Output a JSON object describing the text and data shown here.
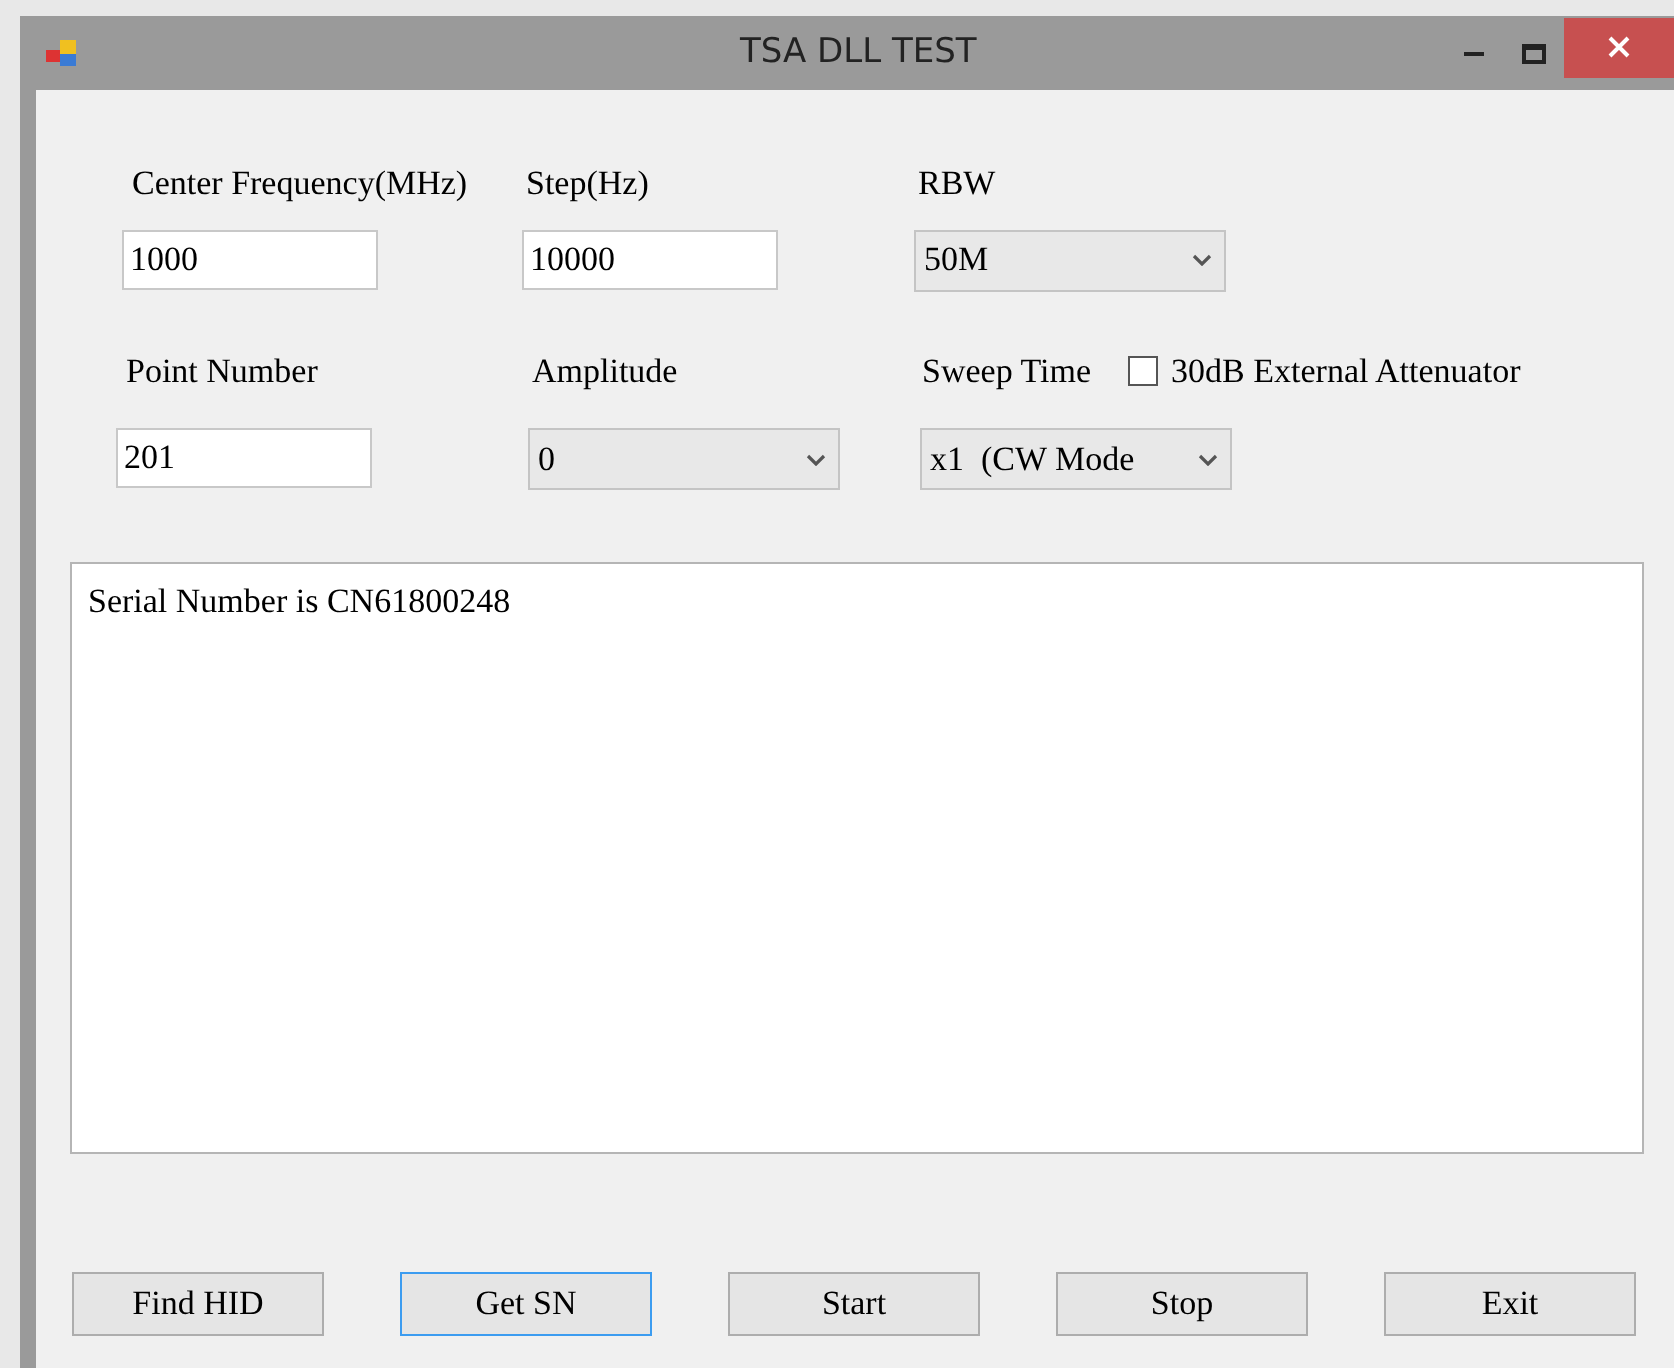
{
  "window": {
    "title": "TSA DLL TEST"
  },
  "fields": [
    {
      "label": "Center Frequency(MHz)",
      "kind": "text",
      "value": "1000"
    },
    {
      "label": "Step(Hz)",
      "kind": "text",
      "value": "10000"
    },
    {
      "label": "RBW",
      "kind": "dropdown",
      "value": "50M"
    },
    {
      "label": "Point Number",
      "kind": "text",
      "value": "201"
    },
    {
      "label": "Amplitude",
      "kind": "dropdown",
      "value": "0"
    },
    {
      "label": "Sweep Time",
      "kind": "dropdown",
      "value": "x1  (CW Mode"
    }
  ],
  "attenuator": {
    "label": "30dB External Attenuator",
    "checked": false
  },
  "log": {
    "value": "Serial Number is CN61800248"
  },
  "buttons": [
    {
      "label": "Find HID",
      "focused": false
    },
    {
      "label": "Get SN",
      "focused": true
    },
    {
      "label": "Start",
      "focused": false
    },
    {
      "label": "Stop",
      "focused": false
    },
    {
      "label": "Exit",
      "focused": false
    }
  ]
}
